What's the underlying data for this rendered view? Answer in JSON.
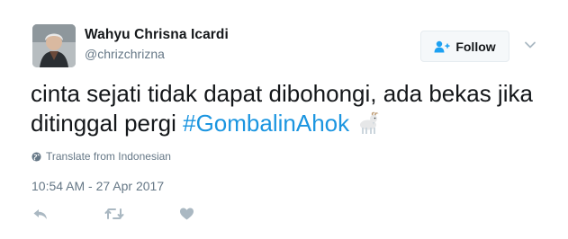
{
  "user": {
    "display_name": "Wahyu Chrisna Icardi",
    "screen_name": "@chrizchrizna",
    "follow_label": "Follow"
  },
  "tweet": {
    "text": "cinta sejati tidak dapat dibohongi, ada bekas jika ditinggal pergi",
    "hashtag": "#GombalinAhok",
    "emoji": "goat",
    "translate_label": "Translate from Indonesian",
    "timestamp": "10:54 AM - 27 Apr 2017"
  },
  "icons": {
    "follow": "add-user-icon",
    "menu": "chevron-down-icon",
    "translate": "globe-icon",
    "reply": "reply-icon",
    "retweet": "retweet-icon",
    "like": "heart-icon"
  },
  "colors": {
    "hashtag": "#1b95e0",
    "secondary_text": "#657786",
    "action_icon": "#aab8c2",
    "follow_icon": "#1da1f2"
  }
}
